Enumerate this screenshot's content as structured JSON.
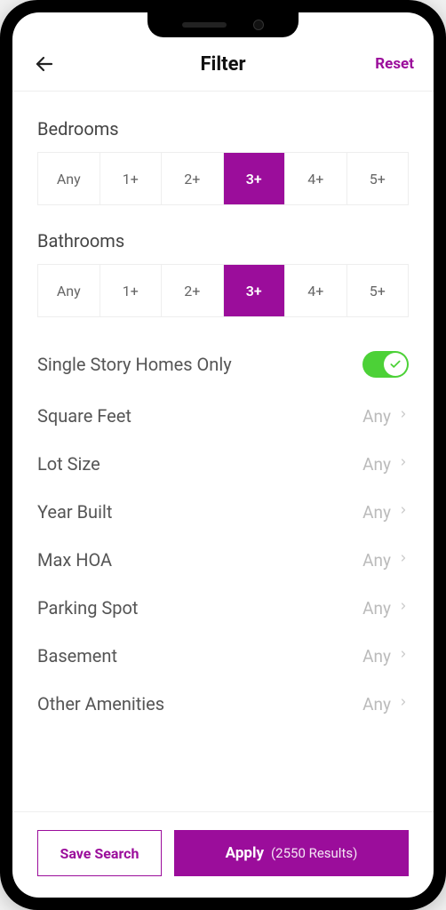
{
  "header": {
    "title": "Filter",
    "reset_label": "Reset"
  },
  "bedrooms": {
    "label": "Bedrooms",
    "options": [
      "Any",
      "1+",
      "2+",
      "3+",
      "4+",
      "5+"
    ],
    "selected_index": 3
  },
  "bathrooms": {
    "label": "Bathrooms",
    "options": [
      "Any",
      "1+",
      "2+",
      "3+",
      "4+",
      "5+"
    ],
    "selected_index": 3
  },
  "single_story": {
    "label": "Single Story Homes Only",
    "enabled": true
  },
  "rows": [
    {
      "label": "Square Feet",
      "value": "Any"
    },
    {
      "label": "Lot Size",
      "value": "Any"
    },
    {
      "label": "Year Built",
      "value": "Any"
    },
    {
      "label": "Max HOA",
      "value": "Any"
    },
    {
      "label": "Parking Spot",
      "value": "Any"
    },
    {
      "label": "Basement",
      "value": "Any"
    },
    {
      "label": "Other Amenities",
      "value": "Any"
    }
  ],
  "footer": {
    "save_label": "Save Search",
    "apply_label": "Apply",
    "results_label": "(2550 Results)"
  },
  "colors": {
    "accent": "#9b0d9b",
    "toggle_on": "#4cd137"
  }
}
